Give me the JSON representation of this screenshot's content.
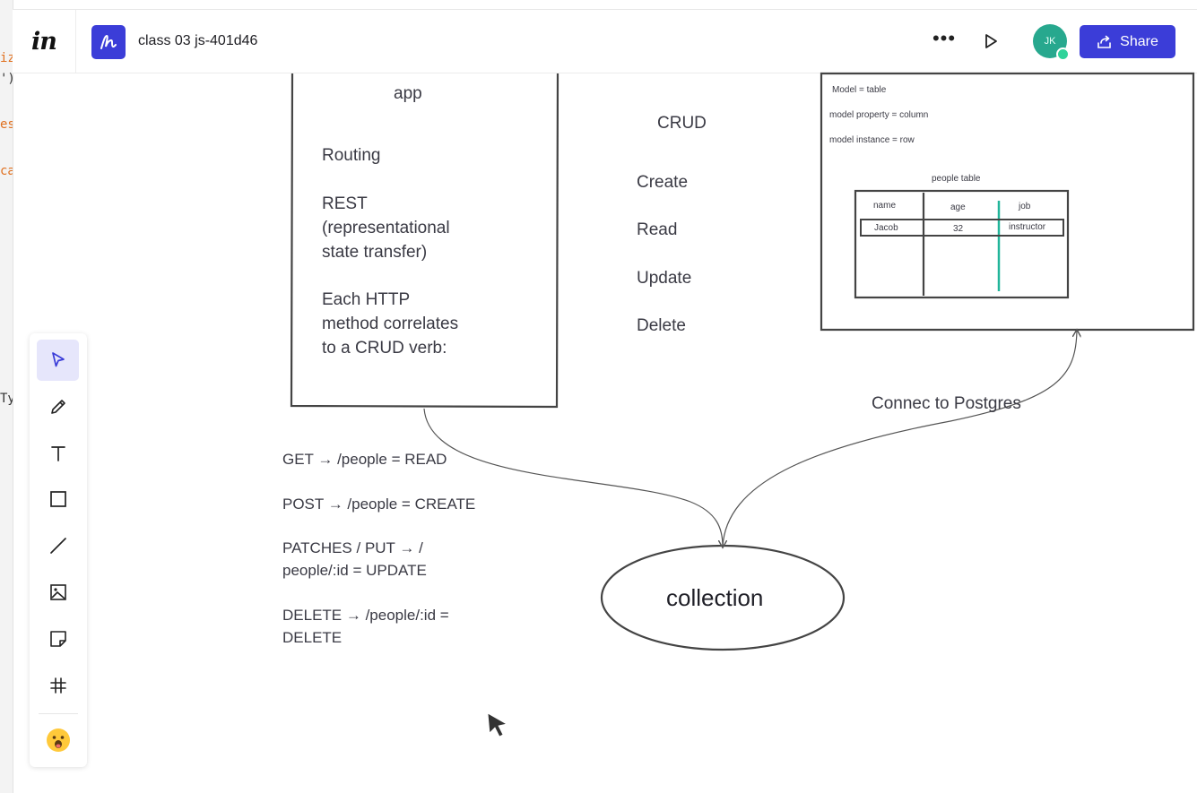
{
  "topbar": {
    "logo": "in",
    "board_title": "class 03 js-401d46",
    "more_label": "•••",
    "avatar_initials": "JK",
    "share_label": "Share"
  },
  "colors": {
    "accent": "#3b3dd8",
    "avatar": "#27a88e",
    "teal_line": "#22b59a"
  },
  "editor_edge": {
    "lines": [
      "iz",
      "')",
      "es",
      "ca",
      "Ty"
    ]
  },
  "toolbar": {
    "tools": [
      "select-arrow-icon",
      "pencil-icon",
      "text-icon",
      "rectangle-icon",
      "line-icon",
      "image-icon",
      "sticky-note-icon",
      "grid-icon",
      "emoji-icon"
    ],
    "active": "select-arrow-icon"
  },
  "canvas": {
    "app_box": {
      "title": "app",
      "routing": "Routing",
      "rest": [
        "REST",
        "(representational",
        "state transfer)"
      ],
      "http": [
        "Each HTTP",
        "method correlates",
        "to a CRUD verb:"
      ]
    },
    "crud": {
      "title": "CRUD",
      "items": [
        "Create",
        "Read",
        "Update",
        "Delete"
      ]
    },
    "model_box": {
      "line1": "Model = table",
      "line2": "model property = column",
      "line3": "model instance = row",
      "table_title": "people table",
      "columns": [
        "name",
        "age",
        "job"
      ],
      "rows": [
        [
          "Jacob",
          "32",
          "instructor"
        ]
      ]
    },
    "connect_label": "Connec to Postgres",
    "routes": [
      [
        "GET → /people = READ"
      ],
      [
        "POST → /people = CREATE"
      ],
      [
        "PATCHES / PUT → /",
        "people/:id = UPDATE"
      ],
      [
        "DELETE → /people/:id =",
        "DELETE"
      ]
    ],
    "collection_label": "collection"
  }
}
